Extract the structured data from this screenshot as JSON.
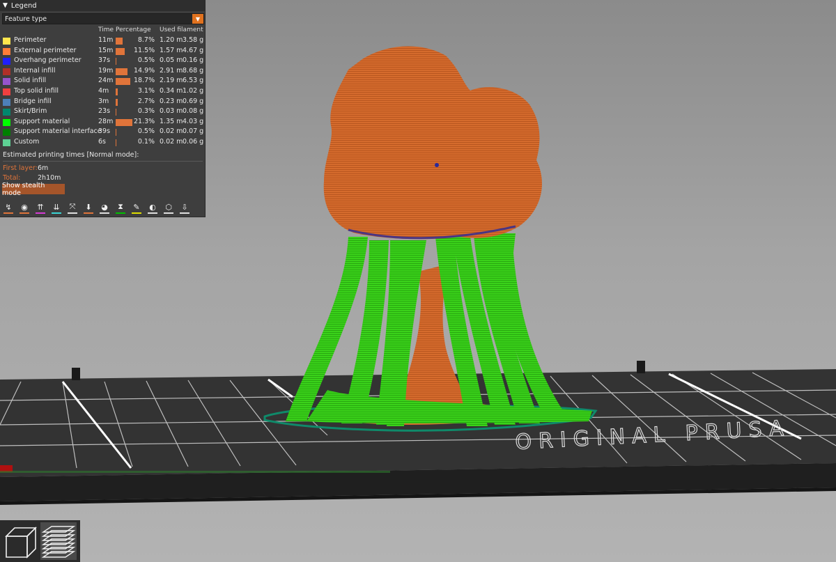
{
  "legend": {
    "title": "Legend",
    "view_type": "Feature type",
    "columns": {
      "time": "Time",
      "percentage": "Percentage",
      "filament": "Used filament"
    },
    "rows": [
      {
        "name": "Perimeter",
        "time": "11m",
        "pct": "8.7%",
        "pct_value": 8.7,
        "length": "1.20 m",
        "weight": "3.58 g",
        "color": "#ffe64d"
      },
      {
        "name": "External perimeter",
        "time": "15m",
        "pct": "11.5%",
        "pct_value": 11.5,
        "length": "1.57 m",
        "weight": "4.67 g",
        "color": "#ff7d38"
      },
      {
        "name": "Overhang perimeter",
        "time": "37s",
        "pct": "0.5%",
        "pct_value": 0.5,
        "length": "0.05 m",
        "weight": "0.16 g",
        "color": "#1f1fff"
      },
      {
        "name": "Internal infill",
        "time": "19m",
        "pct": "14.9%",
        "pct_value": 14.9,
        "length": "2.91 m",
        "weight": "8.68 g",
        "color": "#b03029"
      },
      {
        "name": "Solid infill",
        "time": "24m",
        "pct": "18.7%",
        "pct_value": 18.7,
        "length": "2.19 m",
        "weight": "6.53 g",
        "color": "#9654cc"
      },
      {
        "name": "Top solid infill",
        "time": "4m",
        "pct": "3.1%",
        "pct_value": 3.1,
        "length": "0.34 m",
        "weight": "1.02 g",
        "color": "#f04040"
      },
      {
        "name": "Bridge infill",
        "time": "3m",
        "pct": "2.7%",
        "pct_value": 2.7,
        "length": "0.23 m",
        "weight": "0.69 g",
        "color": "#4d80ba"
      },
      {
        "name": "Skirt/Brim",
        "time": "23s",
        "pct": "0.3%",
        "pct_value": 0.3,
        "length": "0.03 m",
        "weight": "0.08 g",
        "color": "#00876e"
      },
      {
        "name": "Support material",
        "time": "28m",
        "pct": "21.3%",
        "pct_value": 21.3,
        "length": "1.35 m",
        "weight": "4.03 g",
        "color": "#00ff00"
      },
      {
        "name": "Support material interface",
        "time": "39s",
        "pct": "0.5%",
        "pct_value": 0.5,
        "length": "0.02 m",
        "weight": "0.07 g",
        "color": "#008000"
      },
      {
        "name": "Custom",
        "time": "6s",
        "pct": "0.1%",
        "pct_value": 0.1,
        "length": "0.02 m",
        "weight": "0.06 g",
        "color": "#5ed194"
      }
    ],
    "estimated_title": "Estimated printing times [Normal mode]:",
    "first_layer_label": "First layer:",
    "first_layer_value": "6m",
    "total_label": "Total:",
    "total_value": "2h10m",
    "stealth_button": "Show stealth mode"
  },
  "toolbar_icons": [
    {
      "name": "travel-icon",
      "glyph": "↯",
      "accent": "#e0743a"
    },
    {
      "name": "wipe-icon",
      "glyph": "◉",
      "accent": "#e0743a"
    },
    {
      "name": "retractions-icon",
      "glyph": "⇈",
      "accent": "#d53ad5"
    },
    {
      "name": "deretractions-icon",
      "glyph": "⇊",
      "accent": "#3ad5d5"
    },
    {
      "name": "seams-icon",
      "glyph": "⤧",
      "accent": "#e0e0e0"
    },
    {
      "name": "tool-changes-icon",
      "glyph": "⬇",
      "accent": "#e0743a"
    },
    {
      "name": "color-changes-icon",
      "glyph": "◕",
      "accent": "#e0e0e0"
    },
    {
      "name": "pause-prints-icon",
      "glyph": "⧗",
      "accent": "#00c000"
    },
    {
      "name": "custom-gcodes-icon",
      "glyph": "✎",
      "accent": "#e0e000"
    },
    {
      "name": "center-of-gravity-icon",
      "glyph": "◐",
      "accent": "#e0e0e0"
    },
    {
      "name": "shells-icon",
      "glyph": "⬡",
      "accent": "#e0e0e0"
    },
    {
      "name": "tool-marker-icon",
      "glyph": "⇩",
      "accent": "#e0e0e0"
    }
  ],
  "bed_text": "ORIGINAL PRUSA",
  "view_buttons": [
    "3d-view-icon",
    "preview-layers-icon"
  ],
  "colors": {
    "accent": "#e0743a",
    "model": "#d46a2c",
    "support": "#3ccf16",
    "bed": "#2e2e2e"
  }
}
